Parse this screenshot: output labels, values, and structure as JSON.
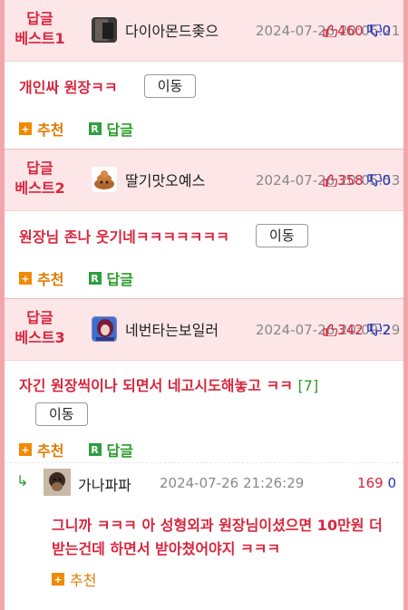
{
  "best": [
    {
      "label": "답글\n베스트1",
      "nickname": "다이아몬드좆으",
      "date": "2024-07-26 20:06:21",
      "up": "460",
      "down": "0",
      "content": "개인싸 원장ㅋㅋ",
      "count": "",
      "move_label": "이동",
      "recommend_label": "추천",
      "reply_label": "답글"
    },
    {
      "label": "답글\n베스트2",
      "nickname": "딸기맛오예스",
      "date": "2024-07-26 20:05:53",
      "up": "358",
      "down": "0",
      "content": "원장님 존나 웃기네ㅋㅋㅋㅋㅋㅋㅋ",
      "count": "",
      "move_label": "이동",
      "recommend_label": "추천",
      "reply_label": "답글"
    },
    {
      "label": "답글\n베스트3",
      "nickname": "네번타는보일러",
      "date": "2024-07-26 20:09:29",
      "up": "342",
      "down": "2",
      "content": "자긴 원장씩이나 되면서 네고시도해놓고 ㅋㅋ ",
      "count": "[7]",
      "move_label": "이동",
      "recommend_label": "추천",
      "reply_label": "답글"
    }
  ],
  "reply": {
    "arrow": "↳",
    "nickname": "가나파파",
    "date": "2024-07-26 21:26:29",
    "up": "169",
    "down": "0",
    "content": "그니까 ㅋㅋㅋ 아 성형외과 원장님이셨으면 10만원 더받는건데 하면서 받아쳤어야지 ㅋㅋㅋ",
    "recommend_label": "추천"
  },
  "icons": {
    "recommend": "plus-box-icon",
    "reply": "r-box-icon",
    "thumb_up": "thumb-up-icon",
    "thumb_down": "thumb-down-icon"
  },
  "colors": {
    "accent_red": "#d7263d",
    "recommend_orange": "#f08a00",
    "reply_green": "#2e9e3e",
    "down_blue": "#2233bb",
    "header_bg": "#fce6e8",
    "frame_border": "#f4a5ab"
  }
}
